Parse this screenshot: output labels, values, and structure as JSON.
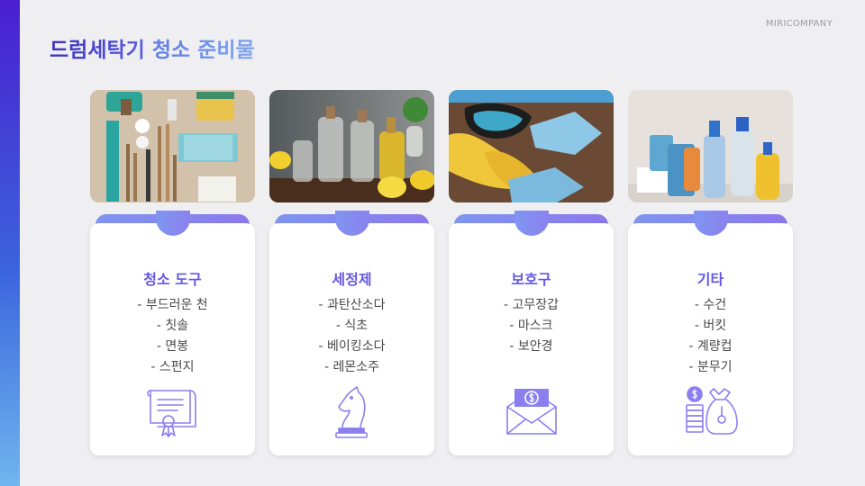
{
  "brand": "MIRICOMPANY",
  "title": {
    "part1": "드럼세탁기",
    "part2": "청소 준비물"
  },
  "colors": {
    "accent_dark": "#4a1fd0",
    "accent_light": "#6fb6ee",
    "card_title": "#6458e0",
    "icon_stroke": "#8b7ff0"
  },
  "cards": [
    {
      "title": "청소 도구",
      "items": [
        "- 부드러운 천",
        "- 칫솔",
        "- 면봉",
        "- 스펀지"
      ],
      "icon": "certificate-icon"
    },
    {
      "title": "세정제",
      "items": [
        "- 과탄산소다",
        "- 식초",
        "- 베이킹소다",
        "- 레몬소주"
      ],
      "icon": "chess-knight-icon"
    },
    {
      "title": "보호구",
      "items": [
        "- 고무장갑",
        "- 마스크",
        "- 보안경"
      ],
      "icon": "money-envelope-icon"
    },
    {
      "title": "기타",
      "items": [
        "- 수건",
        "- 버킷",
        "- 계량컵",
        "- 분무기"
      ],
      "icon": "money-bag-icon"
    }
  ]
}
